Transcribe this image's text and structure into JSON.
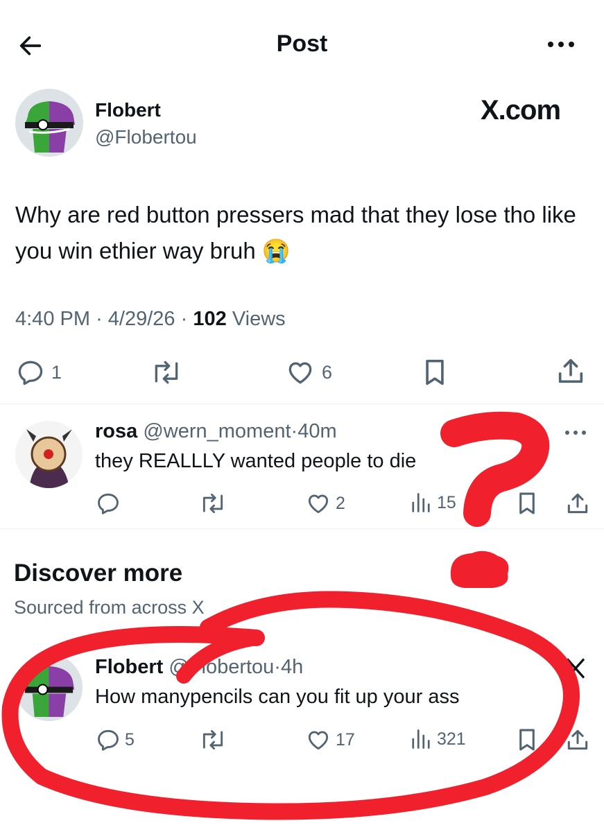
{
  "header": {
    "title": "Post",
    "back_icon": "arrow-left-icon",
    "more_icon": "more-horizontal-icon"
  },
  "main_post": {
    "name": "Flobert",
    "handle": "@Flobertou",
    "watermark": "X.com",
    "text": "Why are red button pressers mad that they lose tho like you win ethier way bruh 😭",
    "time": "4:40 PM",
    "date": "4/29/26",
    "sep": "·",
    "views_count": "102",
    "views_label": "Views",
    "replies": "1",
    "likes": "6"
  },
  "reply": {
    "name": "rosa",
    "handle": "@wern_moment",
    "sep": "·",
    "time": "40m",
    "text": "they REALLLY wanted people to die",
    "likes": "2",
    "views": "15"
  },
  "discover": {
    "title": "Discover more",
    "subtitle": "Sourced from across X"
  },
  "discover_post": {
    "name": "Flobert",
    "handle": "@Flobertou",
    "sep": "·",
    "time": "4h",
    "text": "How manypencils can you fit up your ass",
    "replies": "5",
    "likes": "17",
    "views": "321"
  },
  "colors": {
    "text": "#0f1419",
    "muted": "#536471",
    "annotation": "#f0202c",
    "divider": "#eff3f4"
  }
}
